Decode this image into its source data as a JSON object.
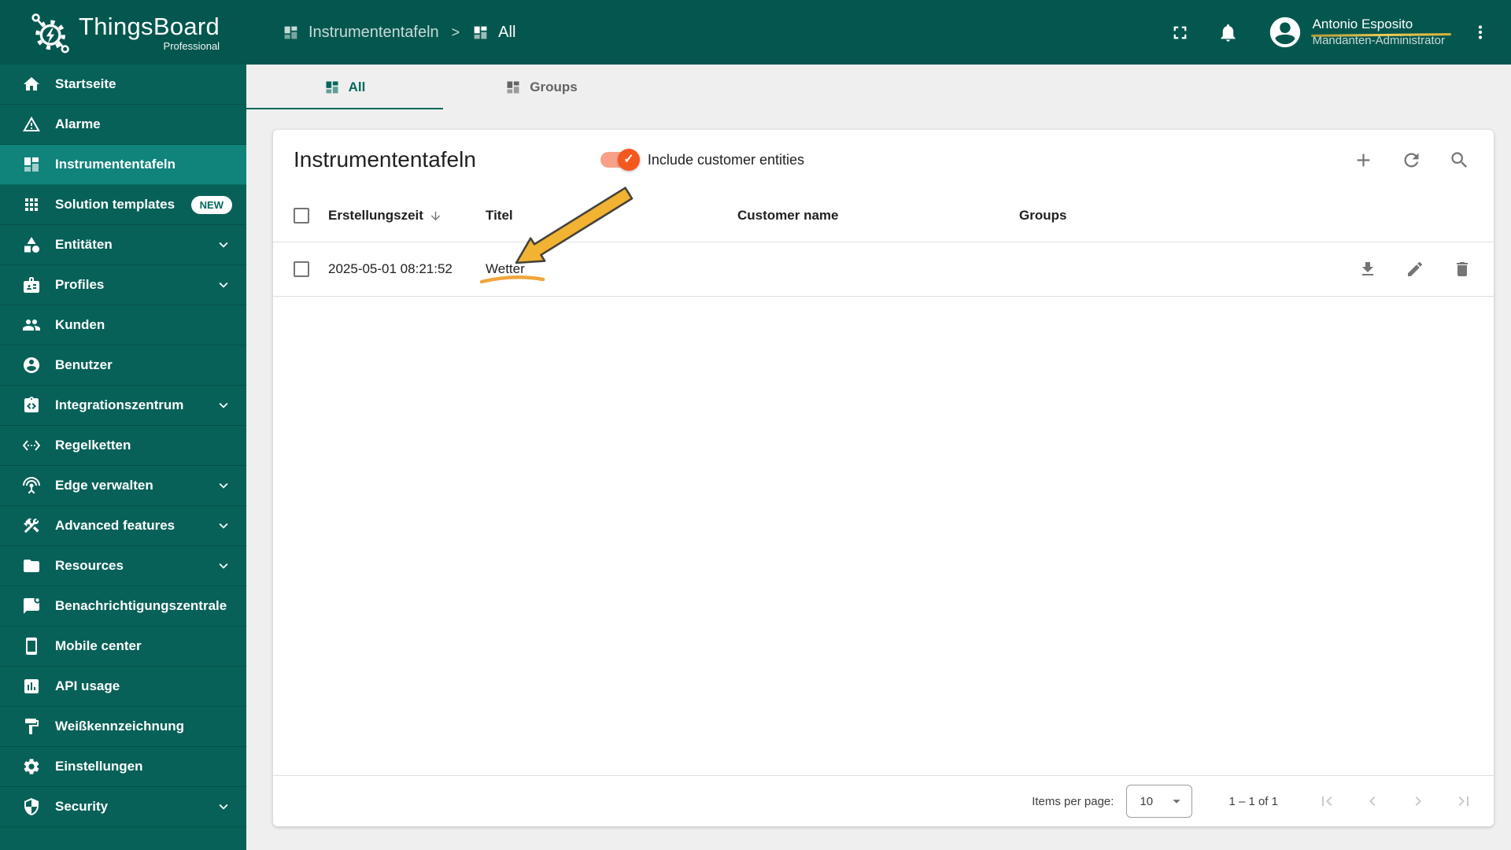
{
  "app": {
    "name": "ThingsBoard",
    "edition": "Professional"
  },
  "header": {
    "breadcrumbs": [
      {
        "label": "Instrumententafeln",
        "icon": "dashboards-icon"
      },
      {
        "label": "All",
        "icon": "dashboards-icon"
      }
    ],
    "separator": ">",
    "user": {
      "name": "Antonio Esposito",
      "role": "Mandanten-Administrator"
    }
  },
  "sidebar": {
    "items": [
      {
        "label": "Startseite",
        "icon": "home-icon"
      },
      {
        "label": "Alarme",
        "icon": "warning-icon"
      },
      {
        "label": "Instrumententafeln",
        "icon": "dashboards-icon",
        "active": true
      },
      {
        "label": "Solution templates",
        "icon": "apps-grid-icon",
        "badge": "NEW"
      },
      {
        "label": "Entitäten",
        "icon": "entities-icon",
        "expandable": true
      },
      {
        "label": "Profiles",
        "icon": "profiles-badge-icon",
        "expandable": true
      },
      {
        "label": "Kunden",
        "icon": "customers-people-icon"
      },
      {
        "label": "Benutzer",
        "icon": "user-circle-icon"
      },
      {
        "label": "Integrationszentrum",
        "icon": "integrations-icon",
        "expandable": true
      },
      {
        "label": "Regelketten",
        "icon": "rule-chains-icon"
      },
      {
        "label": "Edge verwalten",
        "icon": "edge-antenna-icon",
        "expandable": true
      },
      {
        "label": "Advanced features",
        "icon": "advanced-tools-icon",
        "expandable": true
      },
      {
        "label": "Resources",
        "icon": "folder-icon",
        "expandable": true
      },
      {
        "label": "Benachrichtigungszentrale",
        "icon": "notification-center-icon"
      },
      {
        "label": "Mobile center",
        "icon": "smartphone-icon"
      },
      {
        "label": "API usage",
        "icon": "api-chart-icon"
      },
      {
        "label": "Weißkennzeichnung",
        "icon": "white-labeling-paint-icon"
      },
      {
        "label": "Einstellungen",
        "icon": "settings-gear-icon"
      },
      {
        "label": "Security",
        "icon": "security-shield-icon",
        "expandable": true
      }
    ]
  },
  "tabs": [
    {
      "label": "All",
      "icon": "dashboards-icon",
      "active": true
    },
    {
      "label": "Groups",
      "icon": "dashboards-icon",
      "active": false
    }
  ],
  "panel": {
    "title": "Instrumententafeln",
    "toggle_label": "Include customer entities",
    "toggle_checked": true
  },
  "table": {
    "columns": [
      "Erstellungszeit",
      "Titel",
      "Customer name",
      "Groups"
    ],
    "sorted_column": "Erstellungszeit",
    "sort_direction": "descending",
    "rows": [
      {
        "created_time": "2025-05-01 08:21:52",
        "title": "Wetter",
        "customer_name": "",
        "groups": ""
      }
    ]
  },
  "pagination": {
    "items_per_page_label": "Items per page:",
    "items_per_page_value": "10",
    "range_label": "1 – 1 of 1"
  },
  "colors": {
    "brand_teal_dark": "#04574E",
    "brand_teal_sidebar": "#076158",
    "brand_teal_active": "#10837A",
    "accent_teal": "#00695C",
    "accent_orange_thumb": "#F4581F",
    "accent_orange_track": "#F9A089",
    "annotation_yellow": "#F2B232"
  }
}
